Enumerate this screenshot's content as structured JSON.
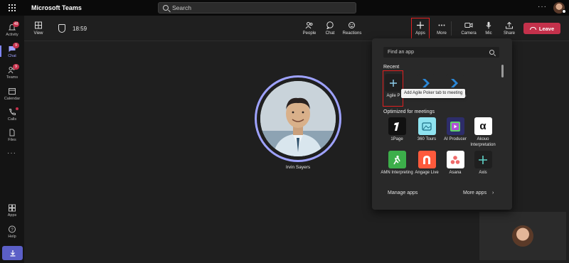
{
  "app": {
    "title": "Microsoft Teams"
  },
  "search": {
    "placeholder": "Search"
  },
  "rail": {
    "items": [
      {
        "label": "Activity",
        "badge": "48"
      },
      {
        "label": "Chat",
        "badge": "9"
      },
      {
        "label": "Teams",
        "badge": "9"
      },
      {
        "label": "Calendar",
        "badge": ""
      },
      {
        "label": "Calls",
        "badge": ""
      },
      {
        "label": "Files",
        "badge": ""
      },
      {
        "label": "Apps",
        "badge": ""
      },
      {
        "label": "Help",
        "badge": ""
      }
    ]
  },
  "toolbar": {
    "view": "View",
    "timer": "18:59",
    "people": "People",
    "chat": "Chat",
    "reactions": "Reactions",
    "apps": "Apps",
    "more": "More",
    "camera": "Camera",
    "mic": "Mic",
    "share": "Share",
    "leave": "Leave"
  },
  "stage": {
    "speaker_name": "Irvin Sayers"
  },
  "apps_flyout": {
    "search_placeholder": "Find an app",
    "recent_title": "Recent",
    "recent": [
      {
        "label": "Agile P",
        "color": "#1f1f1f"
      },
      {
        "label": "Media",
        "color": "#292929"
      },
      {
        "label": "Experiences",
        "color": "#292929"
      }
    ],
    "tooltip": "Add Agile Poker tab to meeting",
    "optimized_title": "Optimized for meetings",
    "optimized": [
      {
        "label": "1Page",
        "color": "#111111"
      },
      {
        "label": "360 Tours",
        "color": "#8fe3f0"
      },
      {
        "label": "AI Producer",
        "color": "#2d2d6a"
      },
      {
        "label": "Akouo Interpretation",
        "color": "#ffffff"
      },
      {
        "label": "AMN Interpreting",
        "color": "#3cae4a"
      },
      {
        "label": "Angage Live",
        "color": "#ff5a3c"
      },
      {
        "label": "Asana",
        "color": "#ffffff"
      },
      {
        "label": "Axis",
        "color": "#1f1f1f"
      }
    ],
    "manage_apps": "Manage apps",
    "more_apps": "More apps"
  },
  "colors": {
    "accent": "#7f85f5",
    "leave": "#c4314b",
    "highlight": "#e02020"
  }
}
